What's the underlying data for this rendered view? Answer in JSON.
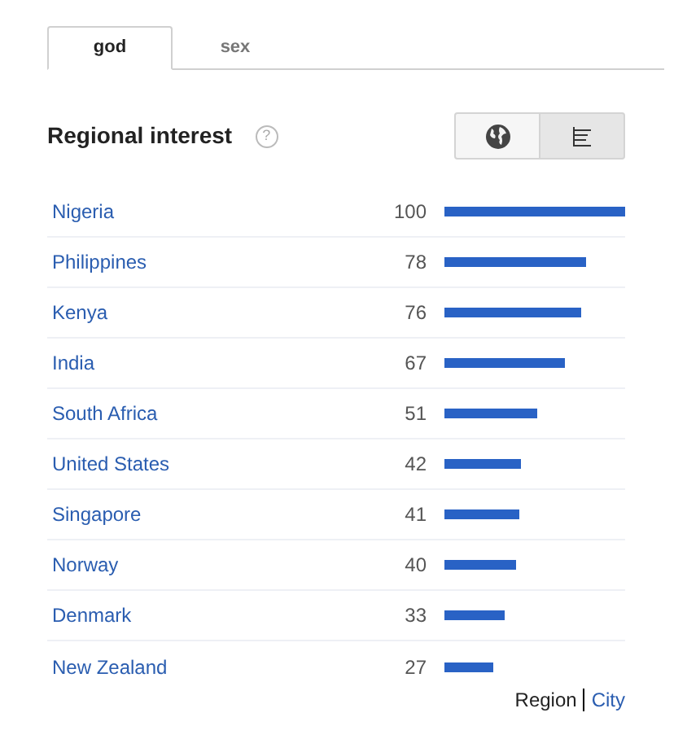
{
  "tabs": [
    {
      "label": "god",
      "selected": true
    },
    {
      "label": "sex",
      "selected": false
    }
  ],
  "section": {
    "title": "Regional interest",
    "help": "?"
  },
  "view_toggle": [
    {
      "kind": "map",
      "selected": false
    },
    {
      "kind": "list",
      "selected": true
    }
  ],
  "rows": [
    {
      "name": "Nigeria",
      "value": "100",
      "level": 1.0
    },
    {
      "name": "Philippines",
      "value": "78",
      "level": 0.78
    },
    {
      "name": "Kenya",
      "value": "76",
      "level": 0.76
    },
    {
      "name": "India",
      "value": "67",
      "level": 0.67
    },
    {
      "name": "South Africa",
      "value": "51",
      "level": 0.51
    },
    {
      "name": "United States",
      "value": "42",
      "level": 0.42
    },
    {
      "name": "Singapore",
      "value": "41",
      "level": 0.41
    },
    {
      "name": "Norway",
      "value": "40",
      "level": 0.4
    },
    {
      "name": "Denmark",
      "value": "33",
      "level": 0.33
    },
    {
      "name": "New Zealand",
      "value": "27",
      "level": 0.27
    }
  ],
  "granularity": [
    {
      "label": "Region",
      "selected": true
    },
    {
      "label": "City",
      "selected": false
    }
  ]
}
